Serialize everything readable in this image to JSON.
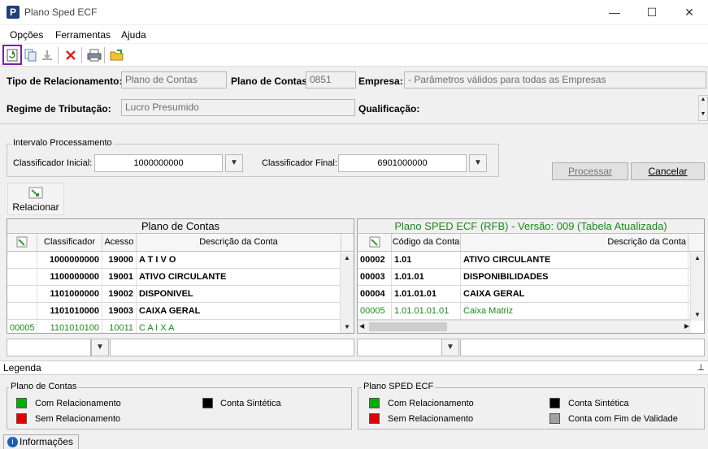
{
  "window": {
    "title": "Plano Sped ECF",
    "minimize_glyph": "—",
    "maximize_glyph": "☐",
    "close_glyph": "✕"
  },
  "menu": {
    "items": [
      "Opções",
      "Ferramentas",
      "Ajuda"
    ]
  },
  "toolbar": {
    "icons": [
      "refresh-icon",
      "copy-icon",
      "export-icon",
      "delete-icon",
      "print-icon",
      "open-folder-icon"
    ]
  },
  "header": {
    "tipo_relacionamento_label": "Tipo de Relacionamento:",
    "tipo_relacionamento_value": "Plano de Contas",
    "plano_contas_label": "Plano de Contas:",
    "plano_contas_value": "0851",
    "empresa_label": "Empresa:",
    "empresa_value": "- Parâmetros válidos para todas as Empresas",
    "regime_label": "Regime de Tributação:",
    "regime_value": "Lucro Presumido",
    "qualificacao_label": "Qualificação:"
  },
  "intervalo": {
    "title": "Intervalo Processamento",
    "inicial_label": "Classificador Inicial:",
    "inicial_value": "1000000000",
    "final_label": "Classificador Final:",
    "final_value": "6901000000"
  },
  "buttons": {
    "processar": "Processar",
    "cancelar": "Cancelar",
    "relacionar": "Relacionar"
  },
  "left_grid": {
    "title": "Plano de Contas",
    "headers": [
      "Classificador",
      "Acesso",
      "Descrição da Conta"
    ],
    "rows": [
      {
        "id": "",
        "classificador": "1000000000",
        "acesso": "19000",
        "descricao": "A T I V O",
        "style": "bold"
      },
      {
        "id": "",
        "classificador": "1100000000",
        "acesso": "19001",
        "descricao": "ATIVO CIRCULANTE",
        "style": "bold"
      },
      {
        "id": "",
        "classificador": "1101000000",
        "acesso": "19002",
        "descricao": "DISPONIVEL",
        "style": "bold"
      },
      {
        "id": "",
        "classificador": "1101010000",
        "acesso": "19003",
        "descricao": "CAIXA GERAL",
        "style": "bold"
      },
      {
        "id": "00005",
        "classificador": "1101010100",
        "acesso": "10011",
        "descricao": "C A I X A",
        "style": "green"
      }
    ]
  },
  "right_grid": {
    "title": "Plano SPED ECF (RFB) - Versão: 009 (Tabela Atualizada)",
    "headers": [
      "Código da Conta",
      "Descrição da Conta"
    ],
    "rows": [
      {
        "id": "00002",
        "codigo": "1.01",
        "descricao": "ATIVO CIRCULANTE",
        "style": "bold"
      },
      {
        "id": "00003",
        "codigo": "1.01.01",
        "descricao": "DISPONIBILIDADES",
        "style": "bold"
      },
      {
        "id": "00004",
        "codigo": "1.01.01.01",
        "descricao": "CAIXA GERAL",
        "style": "bold"
      },
      {
        "id": "00005",
        "codigo": "1.01.01.01.01",
        "descricao": "Caixa Matriz",
        "style": "green"
      }
    ]
  },
  "legend": {
    "bar_title": "Legenda",
    "left_title": "Plano de Contas",
    "right_title": "Plano SPED ECF",
    "com_relacionamento": "Com Relacionamento",
    "sem_relacionamento": "Sem Relacionamento",
    "conta_sintetica": "Conta Sintética",
    "conta_fim_validade": "Conta com Fim de Validade",
    "colors": {
      "green": "#00b000",
      "red": "#e00000",
      "black": "#000000",
      "gray": "#a0a0a0"
    }
  },
  "footer": {
    "info_tab": "Informações"
  }
}
